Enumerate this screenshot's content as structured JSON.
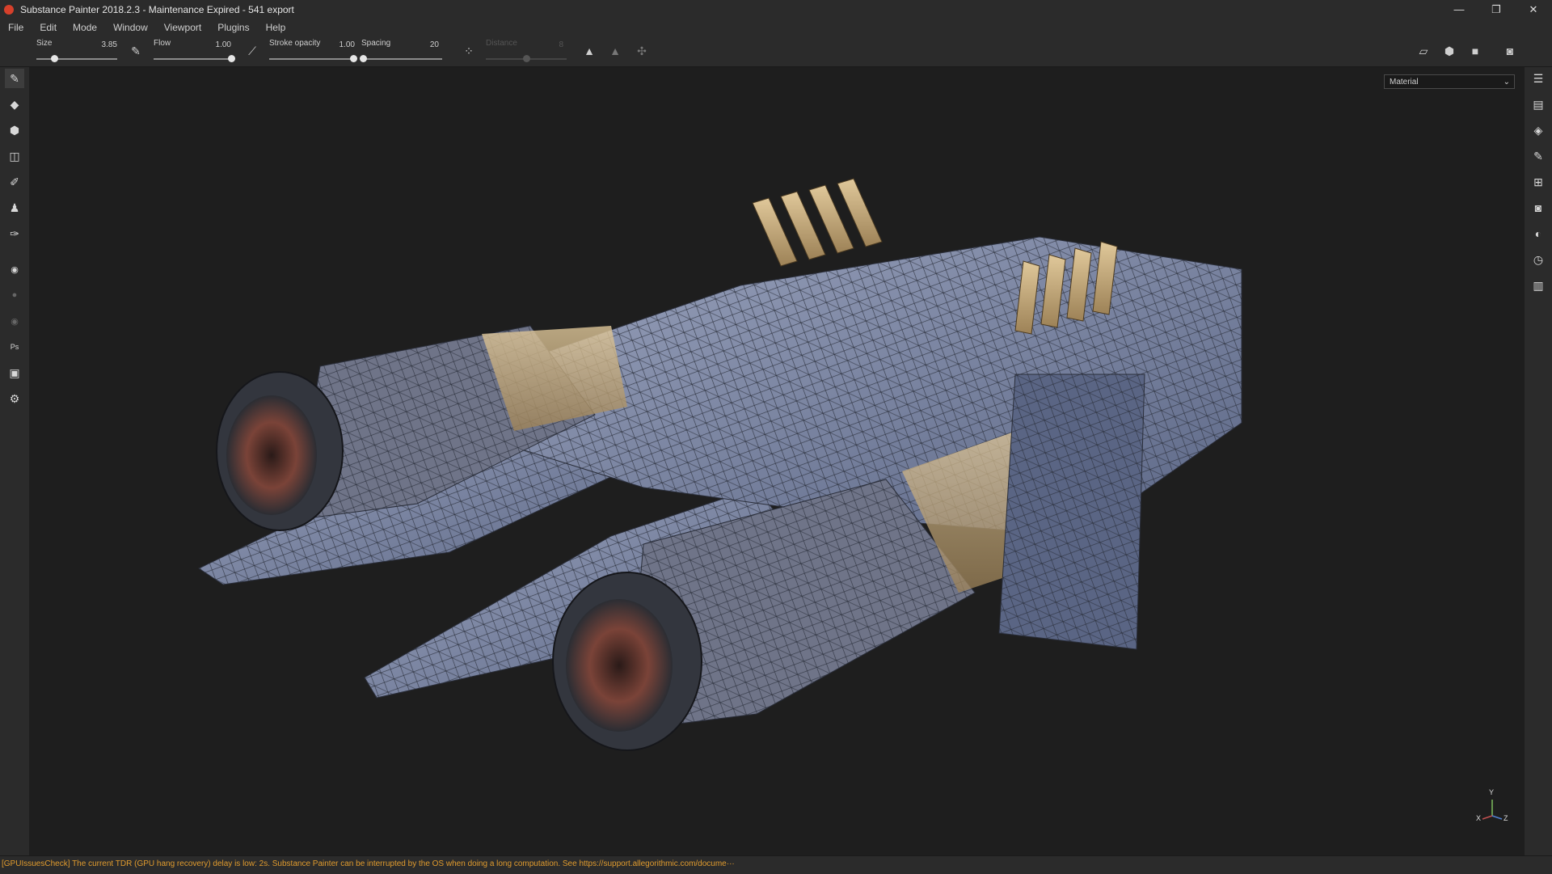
{
  "window": {
    "title": "Substance Painter 2018.2.3 - Maintenance Expired - 541 export",
    "controls": {
      "minimize": "—",
      "restore": "❐",
      "close": "✕"
    }
  },
  "menu": [
    "File",
    "Edit",
    "Mode",
    "Window",
    "Viewport",
    "Plugins",
    "Help"
  ],
  "toolbar": {
    "size": {
      "label": "Size",
      "value": "3.85",
      "level": 0.22
    },
    "flow": {
      "label": "Flow",
      "value": "1.00",
      "level": 1.0
    },
    "stroke_opacity": {
      "label": "Stroke opacity",
      "value": "1.00",
      "level": 1.0
    },
    "spacing": {
      "label": "Spacing",
      "value": "20",
      "level": 0.02
    },
    "distance": {
      "label": "Distance",
      "value": "8",
      "level": 0.5
    }
  },
  "viewport": {
    "display_mode": "Material",
    "axis": {
      "x": "X",
      "y": "Y",
      "z": "Z"
    }
  },
  "status": {
    "message": "[GPUIssuesCheck] The current TDR (GPU hang recovery) delay is low: 2s. Substance Painter can be interrupted by the OS when doing a long computation. See https://support.allegorithmic.com/docume···"
  },
  "colors": {
    "chrome": "#2b2b2b",
    "viewport": "#1e1e1e",
    "warning": "#e09b2e",
    "accent": "#d6402b"
  }
}
